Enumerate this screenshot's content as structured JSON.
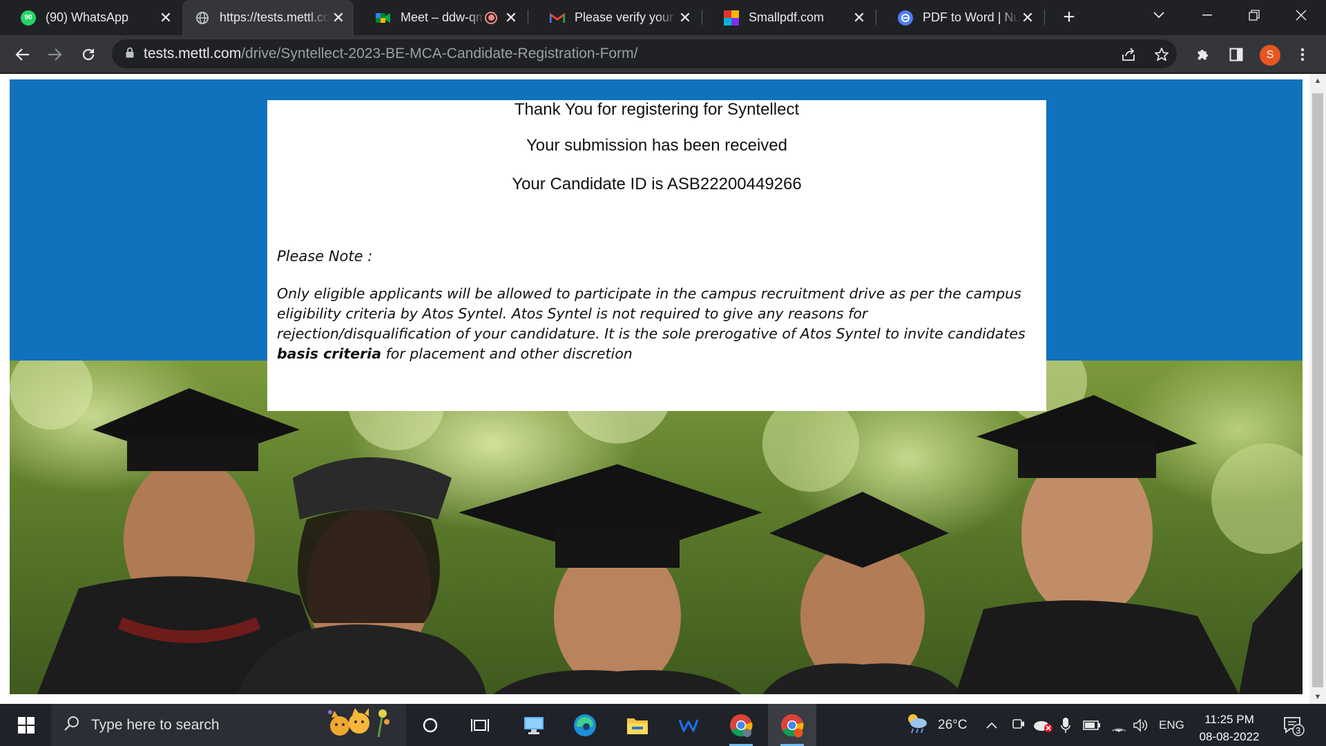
{
  "browser": {
    "tabs": [
      {
        "title": "(90) WhatsApp",
        "badge": "90",
        "icon": "whatsapp-icon"
      },
      {
        "title": "https://tests.mettl.com/drive/",
        "icon": "globe-icon",
        "active": true
      },
      {
        "title": "Meet – ddw-qmzk",
        "icon": "google-meet-icon",
        "recording": true
      },
      {
        "title": "Please verify your email",
        "icon": "gmail-icon"
      },
      {
        "title": "Smallpdf.com",
        "icon": "smallpdf-icon"
      },
      {
        "title": "PDF to Word | NutPDF",
        "icon": "pdf-converter-icon"
      }
    ],
    "new_tab_glyph": "+",
    "address": {
      "domain": "tests.mettl.com",
      "path": "/drive/Syntellect-2023-BE-MCA-Candidate-Registration-Form/"
    },
    "profile_initial": "S"
  },
  "page": {
    "heading_thanks": "Thank You for registering for Syntellect",
    "heading_received": "Your submission has been received",
    "candidate_id_line": "Your Candidate ID is ASB22200449266",
    "note_heading": "Please Note :",
    "note_part1": "Only eligible applicants will be allowed to participate in the campus recruitment drive as per the campus eligibility criteria by Atos Syntel.  Atos Syntel is not required to give any reasons for rejection/disqualification of your candidature. It is the sole prerogative of Atos Syntel to invite candidates ",
    "note_bold": "basis criteria",
    "note_part2": " for placement and other discretion",
    "colors": {
      "banner": "#1072bd",
      "card": "#ffffff"
    }
  },
  "taskbar": {
    "search_placeholder": "Type here to search",
    "weather_temp": "26°C",
    "language": "ENG",
    "time": "11:25 PM",
    "date": "08-08-2022",
    "notification_count": "3"
  }
}
